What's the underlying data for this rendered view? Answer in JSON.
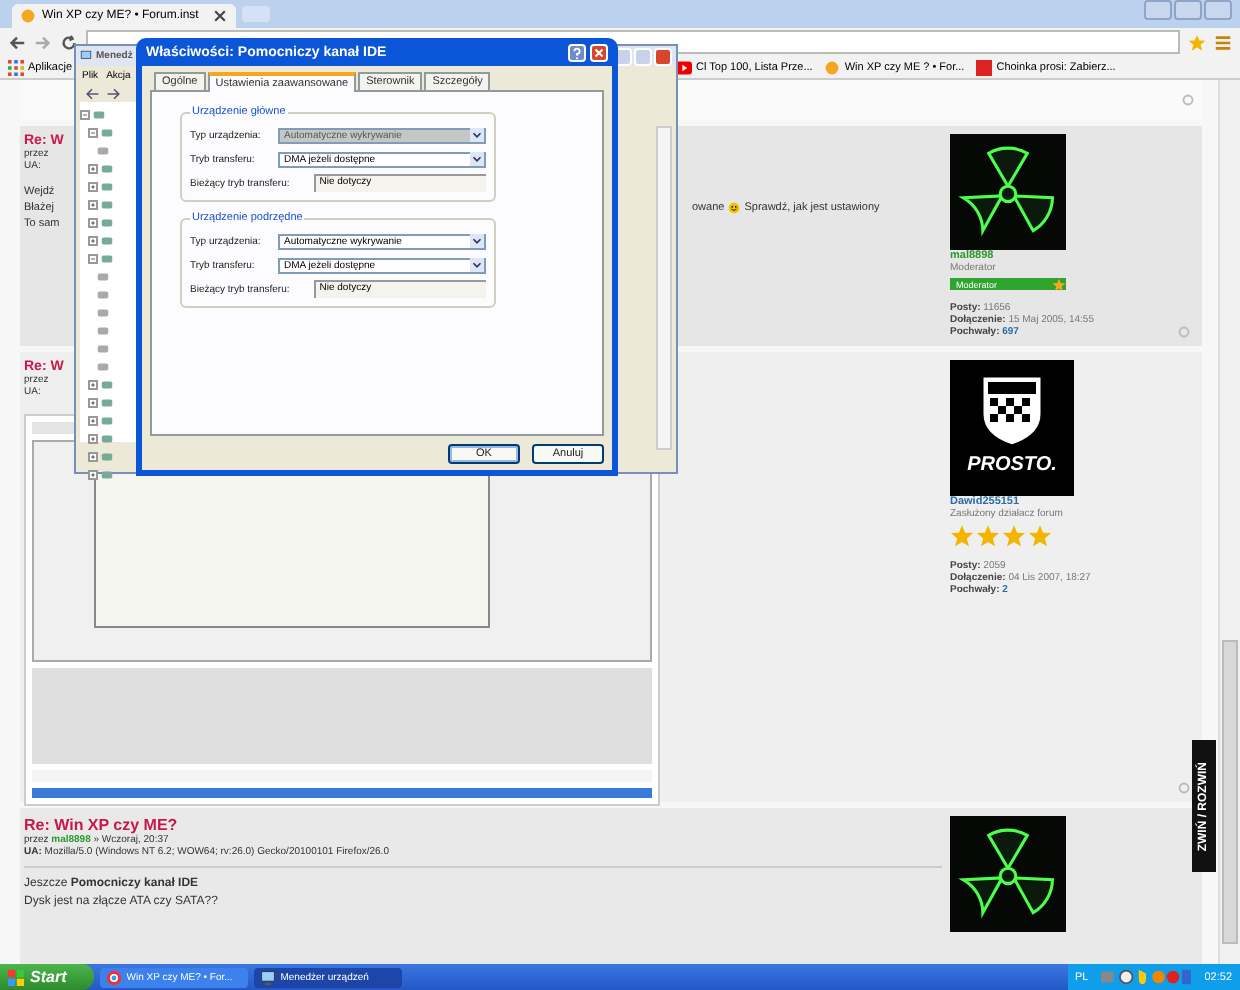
{
  "browser": {
    "tab": {
      "title": "Win XP czy ME? • Forum.inst"
    },
    "bookmarks": [
      {
        "kind": "apps",
        "label": "Aplikacje"
      },
      {
        "kind": "video",
        "label": "Cl Top 100, Lista Prze..."
      },
      {
        "kind": "forum",
        "label": "Win XP czy ME ? • For..."
      },
      {
        "kind": "site",
        "label": "Choinka prosi: Zabierz..."
      }
    ]
  },
  "posts": [
    {
      "kind": "text",
      "title": "Re: W",
      "meta": [
        "przez",
        "UA:"
      ],
      "body": [
        "Wejdź",
        "Błażej",
        "To sam"
      ],
      "aside": [
        "owane",
        "Sprawdź, jak jest ustawiony"
      ],
      "user": {
        "kind": "radiation",
        "name": "mal8898",
        "rank": "Moderator",
        "badge": "Moderator",
        "stats": [
          {
            "label": "Posty:",
            "value": "11656"
          },
          {
            "label": "Dołączenie:",
            "value": "15 Maj 2005, 14:55"
          },
          {
            "label": "Pochwały:",
            "value": "697"
          }
        ]
      }
    },
    {
      "kind": "screenshot",
      "title": "Re: W",
      "meta": [
        "przez",
        "UA:"
      ],
      "user": {
        "kind": "prosto",
        "avatar_text": "PROSTO.",
        "name": "Dawid255151",
        "rank": "Zasłużony działacz forum",
        "stars": 4,
        "stats": [
          {
            "label": "Posty:",
            "value": "2059"
          },
          {
            "label": "Dołączenie:",
            "value": "04 Lis 2007, 18:27"
          },
          {
            "label": "Pochwały:",
            "value": "2"
          }
        ]
      }
    }
  ],
  "last_post": {
    "title": "Re: Win XP czy ME?",
    "by": "przez",
    "author": "mal8898",
    "date": "» Wczoraj, 20:37",
    "ua_label": "UA:",
    "ua": "Mozilla/5.0 (Windows NT 6.2; WOW64; rv:26.0) Gecko/20100101 Firefox/26.0",
    "body": [
      "Jeszcze **Pomocniczy kanał IDE**",
      "Dysk jest na złącze ATA czy SATA??"
    ]
  },
  "side_tab": "ZWIŃ / ROZWIŃ",
  "device_manager": {
    "title": "Menedż",
    "menu": [
      "Plik",
      "Akcja"
    ],
    "tree": [
      {
        "kind": "group",
        "expanded": true,
        "children": [
          {
            "kind": "group",
            "expanded": true,
            "children": [
              {
                "kind": "device"
              }
            ]
          },
          {
            "kind": "group",
            "expanded": false
          },
          {
            "kind": "group",
            "expanded": false
          },
          {
            "kind": "group",
            "expanded": false
          },
          {
            "kind": "group",
            "expanded": false
          },
          {
            "kind": "group",
            "expanded": false
          },
          {
            "kind": "group",
            "expanded": true,
            "children": [
              {
                "kind": "device"
              },
              {
                "kind": "device"
              },
              {
                "kind": "device"
              },
              {
                "kind": "device"
              },
              {
                "kind": "device"
              },
              {
                "kind": "device"
              }
            ]
          },
          {
            "kind": "group",
            "expanded": false
          },
          {
            "kind": "group",
            "expanded": false
          },
          {
            "kind": "group",
            "expanded": false
          },
          {
            "kind": "group",
            "expanded": false
          },
          {
            "kind": "group",
            "expanded": false
          },
          {
            "kind": "group",
            "expanded": false
          }
        ]
      }
    ]
  },
  "dialog": {
    "title": "Właściwości: Pomocniczy kanał IDE",
    "tabs": [
      {
        "label": "Ogólne",
        "selected": false
      },
      {
        "label": "Ustawienia zaawansowane",
        "selected": true
      },
      {
        "label": "Sterownik",
        "selected": false
      },
      {
        "label": "Szczegóły",
        "selected": false
      }
    ],
    "groups": [
      {
        "title": "Urządzenie główne",
        "rows": [
          {
            "kind": "select",
            "label": "Typ urządzenia:",
            "value": "Automatyczne wykrywanie",
            "disabled": true
          },
          {
            "kind": "select",
            "label": "Tryb transferu:",
            "value": "DMA jeżeli dostępne",
            "disabled": false
          },
          {
            "kind": "readonly",
            "label": "Bieżący tryb transferu:",
            "value": "Nie dotyczy"
          }
        ]
      },
      {
        "title": "Urządzenie podrzędne",
        "rows": [
          {
            "kind": "select",
            "label": "Typ urządzenia:",
            "value": "Automatyczne wykrywanie",
            "disabled": false
          },
          {
            "kind": "select",
            "label": "Tryb transferu:",
            "value": "DMA jeżeli dostępne",
            "disabled": false
          },
          {
            "kind": "readonly",
            "label": "Bieżący tryb transferu:",
            "value": "Nie dotyczy"
          }
        ]
      }
    ],
    "buttons": [
      "OK",
      "Anuluj"
    ]
  },
  "taskbar": {
    "start": "Start",
    "tasks": [
      {
        "kind": "browser",
        "label": "Win XP czy ME? • For...",
        "selected": false
      },
      {
        "kind": "devices",
        "label": "Menedżer urządzeń",
        "selected": true
      }
    ],
    "language": "PL",
    "clock": "02:52"
  }
}
